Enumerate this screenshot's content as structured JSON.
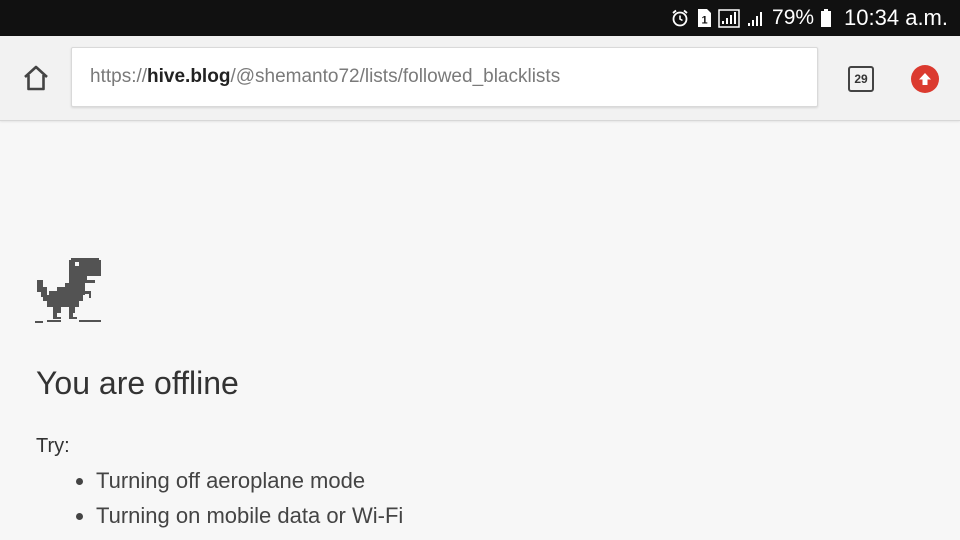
{
  "status_bar": {
    "battery_percent": "79%",
    "time": "10:34 a.m.",
    "icons": [
      "alarm-icon",
      "sim-1-icon",
      "signal-strength-icon",
      "signal-strength-icon",
      "battery-icon"
    ]
  },
  "toolbar": {
    "url_scheme": "https://",
    "url_host": "hive.blog",
    "url_path": "/@shemanto72/lists/followed_blacklists",
    "tab_count": "29",
    "home_icon": "home-icon",
    "update_icon": "update-arrow-icon",
    "update_color": "#db3a2f"
  },
  "main": {
    "heading": "You are offline",
    "try_label": "Try:",
    "suggestions": [
      "Turning off aeroplane mode",
      "Turning on mobile data or Wi-Fi"
    ],
    "illustration": "offline-dinosaur-icon"
  }
}
